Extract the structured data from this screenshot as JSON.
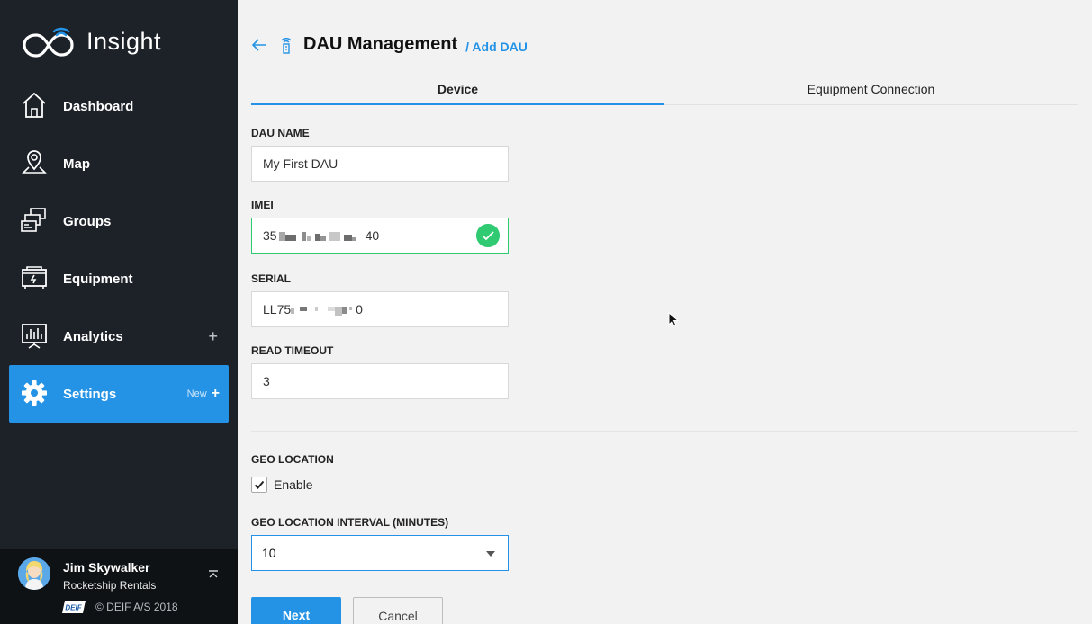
{
  "app": {
    "name": "Insight"
  },
  "sidebar": {
    "items": [
      {
        "label": "Dashboard",
        "icon": "home-icon"
      },
      {
        "label": "Map",
        "icon": "map-pin-icon"
      },
      {
        "label": "Groups",
        "icon": "groups-icon"
      },
      {
        "label": "Equipment",
        "icon": "equipment-icon"
      },
      {
        "label": "Analytics",
        "icon": "analytics-icon",
        "expand": "+"
      },
      {
        "label": "Settings",
        "icon": "gear-icon",
        "badge": "New",
        "expand": "+",
        "active": true
      }
    ]
  },
  "user": {
    "name": "Jim Skywalker",
    "company": "Rocketship Rentals",
    "brand": "DEIF",
    "copyright": "© DEIF A/S 2018"
  },
  "header": {
    "title": "DAU Management",
    "breadcrumb": "/ Add DAU"
  },
  "tabs": [
    {
      "label": "Device",
      "active": true
    },
    {
      "label": "Equipment Connection",
      "active": false
    }
  ],
  "form": {
    "dau_name": {
      "label": "DAU NAME",
      "value": "My First DAU"
    },
    "imei": {
      "label": "IMEI",
      "prefix": "35",
      "suffix": "40",
      "valid": true
    },
    "serial": {
      "label": "SERIAL",
      "prefix": "LL75",
      "suffix": "0"
    },
    "read_timeout": {
      "label": "READ TIMEOUT",
      "value": "3"
    },
    "geo_location": {
      "label": "GEO LOCATION",
      "checkbox_label": "Enable",
      "checked": true
    },
    "geo_interval": {
      "label": "GEO LOCATION INTERVAL (MINUTES)",
      "value": "10"
    }
  },
  "actions": {
    "next": "Next",
    "cancel": "Cancel"
  },
  "colors": {
    "accent": "#2493e6",
    "sidebar": "#1d2228",
    "valid": "#2fca72"
  }
}
